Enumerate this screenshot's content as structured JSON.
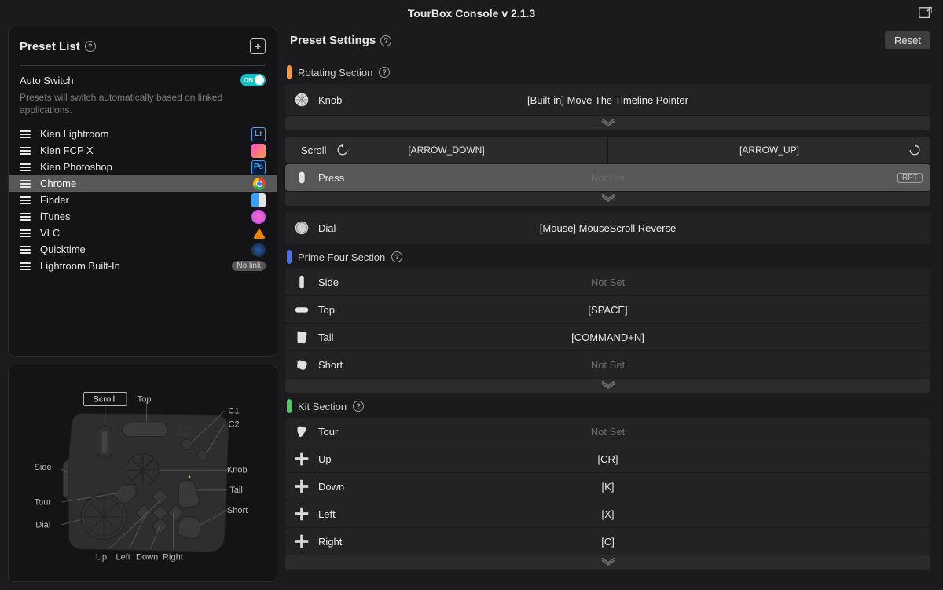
{
  "title": "TourBox Console v 2.1.3",
  "left": {
    "heading": "Preset List",
    "autoswitch_label": "Auto Switch",
    "autoswitch_on": "ON",
    "autoswitch_desc": "Presets will switch automatically based on linked applications.",
    "presets": [
      {
        "name": "Kien Lightroom",
        "icon": "lr"
      },
      {
        "name": "Kien FCP X",
        "icon": "fcp"
      },
      {
        "name": "Kien Photoshop",
        "icon": "ps"
      },
      {
        "name": "Chrome",
        "icon": "chrome",
        "selected": true
      },
      {
        "name": "Finder",
        "icon": "finder"
      },
      {
        "name": "iTunes",
        "icon": "itunes"
      },
      {
        "name": "VLC",
        "icon": "vlc"
      },
      {
        "name": "Quicktime",
        "icon": "qt"
      },
      {
        "name": "Lightroom Built-In",
        "nolink": true
      }
    ],
    "nolink_label": "No link"
  },
  "device": {
    "labels": {
      "scroll": "Scroll",
      "top": "Top",
      "c1": "C1",
      "c2": "C2",
      "side": "Side",
      "tour": "Tour",
      "dial": "Dial",
      "knob": "Knob",
      "tall": "Tall",
      "short": "Short",
      "up": "Up",
      "left": "Left",
      "down": "Down",
      "right": "Right"
    }
  },
  "right": {
    "heading": "Preset Settings",
    "reset": "Reset",
    "sections": [
      {
        "title": "Rotating Section",
        "color": "#f39a3e",
        "rows": [
          {
            "label": "Knob",
            "assign": "[Built-in] Move The Timeline Pointer",
            "kind": "knob"
          },
          {
            "kind": "chevron"
          },
          {
            "kind": "split",
            "label": "Scroll",
            "left": "[ARROW_DOWN]",
            "right": "[ARROW_UP]"
          },
          {
            "label": "Press",
            "assign": "Not Set",
            "muted": true,
            "kind": "press",
            "selected": true,
            "rpt": "RPT"
          },
          {
            "kind": "chevron"
          },
          {
            "label": "Dial",
            "assign": "[Mouse] MouseScroll Reverse",
            "kind": "dial"
          }
        ]
      },
      {
        "title": "Prime Four Section",
        "color": "#4f6fe6",
        "rows": [
          {
            "label": "Side",
            "assign": "Not Set",
            "muted": true,
            "kind": "side"
          },
          {
            "label": "Top",
            "assign": "[SPACE]",
            "kind": "top"
          },
          {
            "label": "Tall",
            "assign": "[COMMAND+N]",
            "kind": "tall"
          },
          {
            "label": "Short",
            "assign": "Not Set",
            "muted": true,
            "kind": "short"
          },
          {
            "kind": "chevron"
          }
        ]
      },
      {
        "title": "Kit Section",
        "color": "#58c66e",
        "rows": [
          {
            "label": "Tour",
            "assign": "Not Set",
            "muted": true,
            "kind": "tour"
          },
          {
            "label": "Up",
            "assign": "[CR]",
            "kind": "dpad"
          },
          {
            "label": "Down",
            "assign": "[K]",
            "kind": "dpad"
          },
          {
            "label": "Left",
            "assign": "[X]",
            "kind": "dpad"
          },
          {
            "label": "Right",
            "assign": "[C]",
            "kind": "dpad"
          },
          {
            "kind": "chevron"
          }
        ]
      }
    ]
  }
}
